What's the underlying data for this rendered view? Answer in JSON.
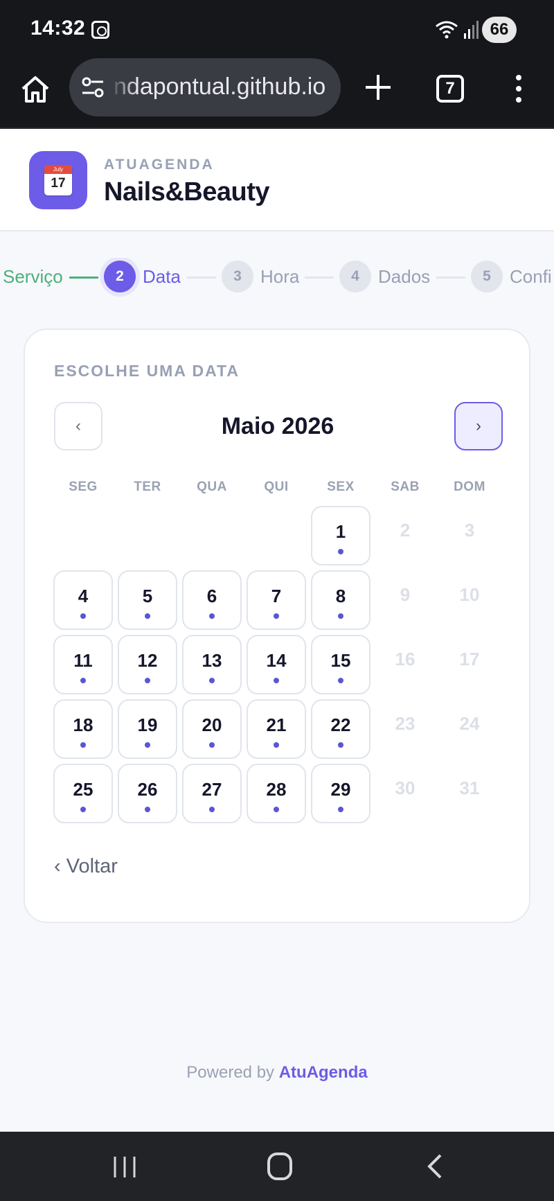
{
  "status_bar": {
    "time": "14:32",
    "battery": "66"
  },
  "browser": {
    "url": "ndapontual.github.io",
    "tab_count": "7"
  },
  "header": {
    "logo_month": "July",
    "logo_day": "17",
    "kicker": "ATUAGENDA",
    "business_name": "Nails&Beauty"
  },
  "stepper": {
    "steps": [
      {
        "number": "",
        "label": "Serviço",
        "state": "completed"
      },
      {
        "number": "2",
        "label": "Data",
        "state": "active"
      },
      {
        "number": "3",
        "label": "Hora",
        "state": "pending"
      },
      {
        "number": "4",
        "label": "Dados",
        "state": "pending"
      },
      {
        "number": "5",
        "label": "Confi",
        "state": "pending"
      }
    ]
  },
  "calendar": {
    "title": "ESCOLHE UMA DATA",
    "prev_label": "‹",
    "next_label": "›",
    "month": "Maio 2026",
    "weekdays": [
      "SEG",
      "TER",
      "QUA",
      "QUI",
      "SEX",
      "SAB",
      "DOM"
    ],
    "first_weekday_index": 4,
    "days": [
      {
        "d": "1",
        "available": true
      },
      {
        "d": "2",
        "available": false
      },
      {
        "d": "3",
        "available": false
      },
      {
        "d": "4",
        "available": true
      },
      {
        "d": "5",
        "available": true
      },
      {
        "d": "6",
        "available": true
      },
      {
        "d": "7",
        "available": true
      },
      {
        "d": "8",
        "available": true
      },
      {
        "d": "9",
        "available": false
      },
      {
        "d": "10",
        "available": false
      },
      {
        "d": "11",
        "available": true
      },
      {
        "d": "12",
        "available": true
      },
      {
        "d": "13",
        "available": true
      },
      {
        "d": "14",
        "available": true
      },
      {
        "d": "15",
        "available": true
      },
      {
        "d": "16",
        "available": false
      },
      {
        "d": "17",
        "available": false
      },
      {
        "d": "18",
        "available": true
      },
      {
        "d": "19",
        "available": true
      },
      {
        "d": "20",
        "available": true
      },
      {
        "d": "21",
        "available": true
      },
      {
        "d": "22",
        "available": true
      },
      {
        "d": "23",
        "available": false
      },
      {
        "d": "24",
        "available": false
      },
      {
        "d": "25",
        "available": true
      },
      {
        "d": "26",
        "available": true
      },
      {
        "d": "27",
        "available": true
      },
      {
        "d": "28",
        "available": true
      },
      {
        "d": "29",
        "available": true
      },
      {
        "d": "30",
        "available": false
      },
      {
        "d": "31",
        "available": false
      }
    ],
    "back_label": "‹ Voltar"
  },
  "footer": {
    "powered_prefix": "Powered by ",
    "powered_brand": "AtuAgenda"
  },
  "colors": {
    "accent": "#6c5ce7",
    "completed": "#4caf7d",
    "muted": "#98a0b3"
  },
  "icons": {
    "status": [
      "screenshot-icon",
      "wifi-icon",
      "signal-icon"
    ],
    "browser": [
      "home-icon",
      "site-settings-icon",
      "plus-icon",
      "tabs-icon",
      "more-menu-icon"
    ],
    "system": [
      "recents-icon",
      "home-nav-icon",
      "back-nav-icon"
    ]
  }
}
